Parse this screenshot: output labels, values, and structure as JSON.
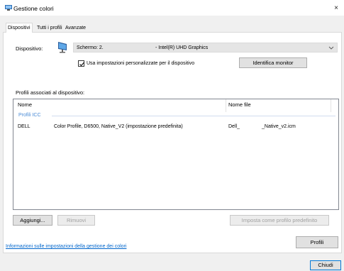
{
  "window": {
    "title": "Gestione colori",
    "close_glyph": "×"
  },
  "tabs": [
    {
      "label": "Dispositivi",
      "active": true
    },
    {
      "label": "Tutti i profili",
      "active": false
    },
    {
      "label": "Avanzate",
      "active": false
    }
  ],
  "device": {
    "label": "Dispositivo:",
    "screen": "Schermo: 2.",
    "adapter": "- Intel(R) UHD Graphics",
    "icon": "monitor-icon",
    "custom_settings_label": "Usa impostazioni personalizzate per il dispositivo",
    "custom_settings_checked": true,
    "identify_button": "Identifica monitor"
  },
  "profiles": {
    "section_label": "Profili associati al dispositivo:",
    "columns": [
      "Nome",
      "Nome file"
    ],
    "group_label": "Profili ICC",
    "rows": [
      {
        "name_prefix": "DELL",
        "name_suffix": "Color Profile, D6500, Native_V2 (impostazione predefinita)",
        "file_prefix": "Dell_",
        "file_suffix": "_Native_v2.icm"
      }
    ]
  },
  "actions": {
    "add": "Aggiungi...",
    "remove": "Rimuovi",
    "set_default": "Imposta come profilo predefinito"
  },
  "bottom": {
    "info_link": "Informazioni sulle impostazioni della gestione dei colori",
    "profiles_button": "Profili",
    "close_button": "Chiudi"
  },
  "colors": {
    "accent": "#0078d7",
    "link": "#0066cc",
    "group": "#4a8bd6"
  }
}
